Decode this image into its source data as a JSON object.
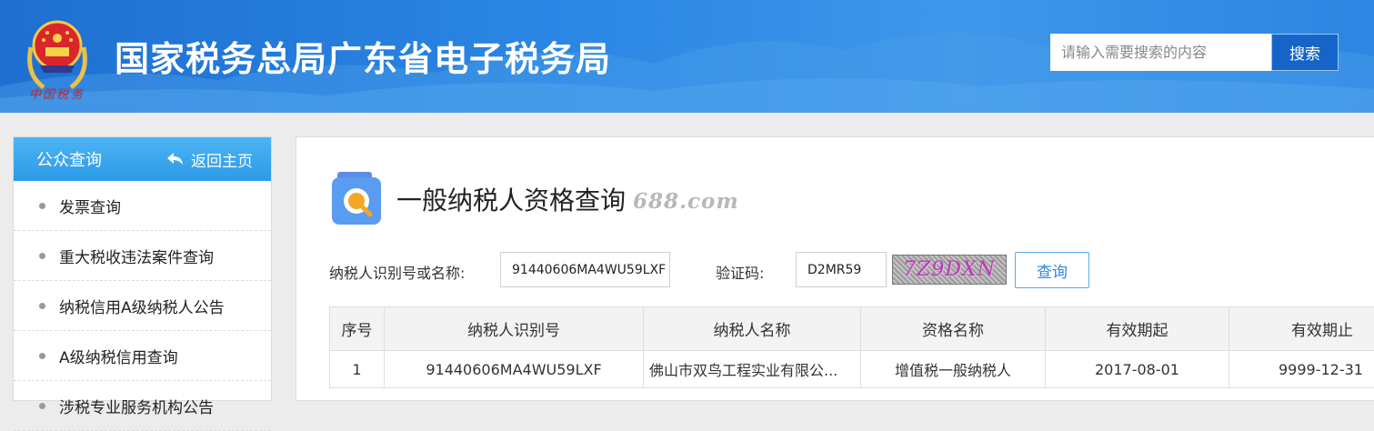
{
  "header": {
    "site_title": "国家税务总局广东省电子税务局",
    "emblem_caption": "中国税务",
    "search_placeholder": "请输入需要搜索的内容",
    "search_button": "搜索"
  },
  "sidebar": {
    "title": "公众查询",
    "back_label": "返回主页",
    "items": [
      {
        "label": "发票查询"
      },
      {
        "label": "重大税收违法案件查询"
      },
      {
        "label": "纳税信用A级纳税人公告"
      },
      {
        "label": "A级纳税信用查询"
      },
      {
        "label": "涉税专业服务机构公告"
      }
    ]
  },
  "main": {
    "title": "一般纳税人资格查询",
    "watermark": "688.com",
    "form": {
      "taxpayer_label": "纳税人识别号或名称:",
      "taxpayer_value": "91440606MA4WU59LXF",
      "captcha_label": "验证码:",
      "captcha_value": "D2MR59",
      "captcha_image_text": "7Z9DXN",
      "query_button": "查询"
    },
    "table": {
      "headers": [
        "序号",
        "纳税人识别号",
        "纳税人名称",
        "资格名称",
        "有效期起",
        "有效期止"
      ],
      "rows": [
        [
          "1",
          "91440606MA4WU59LXF",
          "佛山市双鸟工程实业有限公...",
          "增值税一般纳税人",
          "2017-08-01",
          "9999-12-31"
        ]
      ]
    }
  },
  "colors": {
    "header_blue": "#2a86e4",
    "sidebar_head_blue": "#2c9ae8",
    "accent": "#2b88e0"
  }
}
